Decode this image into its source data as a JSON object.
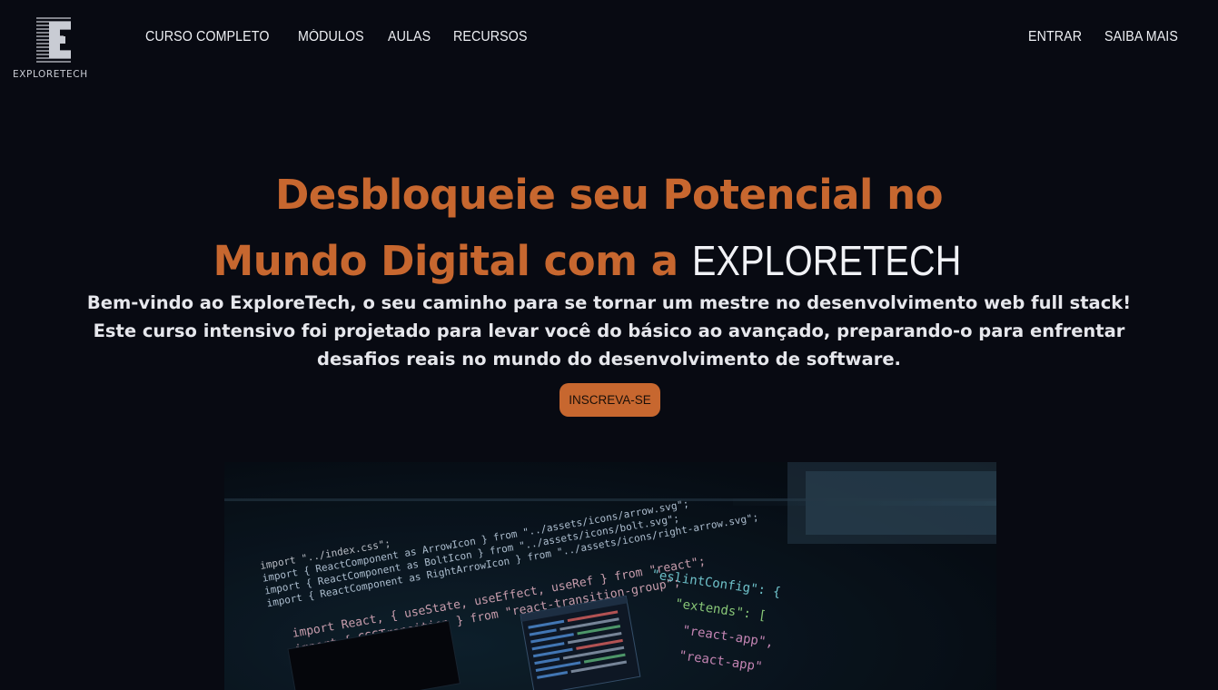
{
  "header": {
    "logo_text": "EXPLORETECH",
    "nav_left": [
      "CURSO COMPLETO",
      "MÓDULOS",
      "AULAS",
      "RECURSOS"
    ],
    "nav_right": [
      "ENTRAR",
      "SAIBA MAIS"
    ]
  },
  "hero": {
    "title_line1": "Desbloqueie seu Potencial no",
    "title_line2": "Mundo Digital com a",
    "title_brand": "EXPLORETECH",
    "subtitle": "Bem-vindo ao ExploreTech, o seu caminho para se tornar um mestre no desenvolvimento web full stack! Este curso intensivo foi projetado para levar você do básico ao avançado, preparando-o para enfrentar desafios reais no mundo do desenvolvimento de software.",
    "cta_label": "INSCREVA-SE"
  },
  "image": {
    "code_lines": [
      "import \"../index.css\";",
      "import { ReactComponent as ArrowIcon } from \"../assets/icons/arrow.svg\";",
      "import { ReactComponent as BoltIcon } from \"../assets/icons/bolt.svg\";",
      "import { ReactComponent as RightArrowIcon } from \"../assets/icons/right-arrow.svg\";",
      "import React, { useState, useEffect, useRef } from \"react\";",
      "import { CSSTransition } from \"react-transition-group\";"
    ],
    "config_lines": [
      "\"eslintConfig\": {",
      "\"extends\": [",
      "\"react-app\",",
      "\"react-app\""
    ]
  },
  "colors": {
    "background": "#080a12",
    "accent": "#c7672f",
    "text": "#f2f2f2"
  }
}
